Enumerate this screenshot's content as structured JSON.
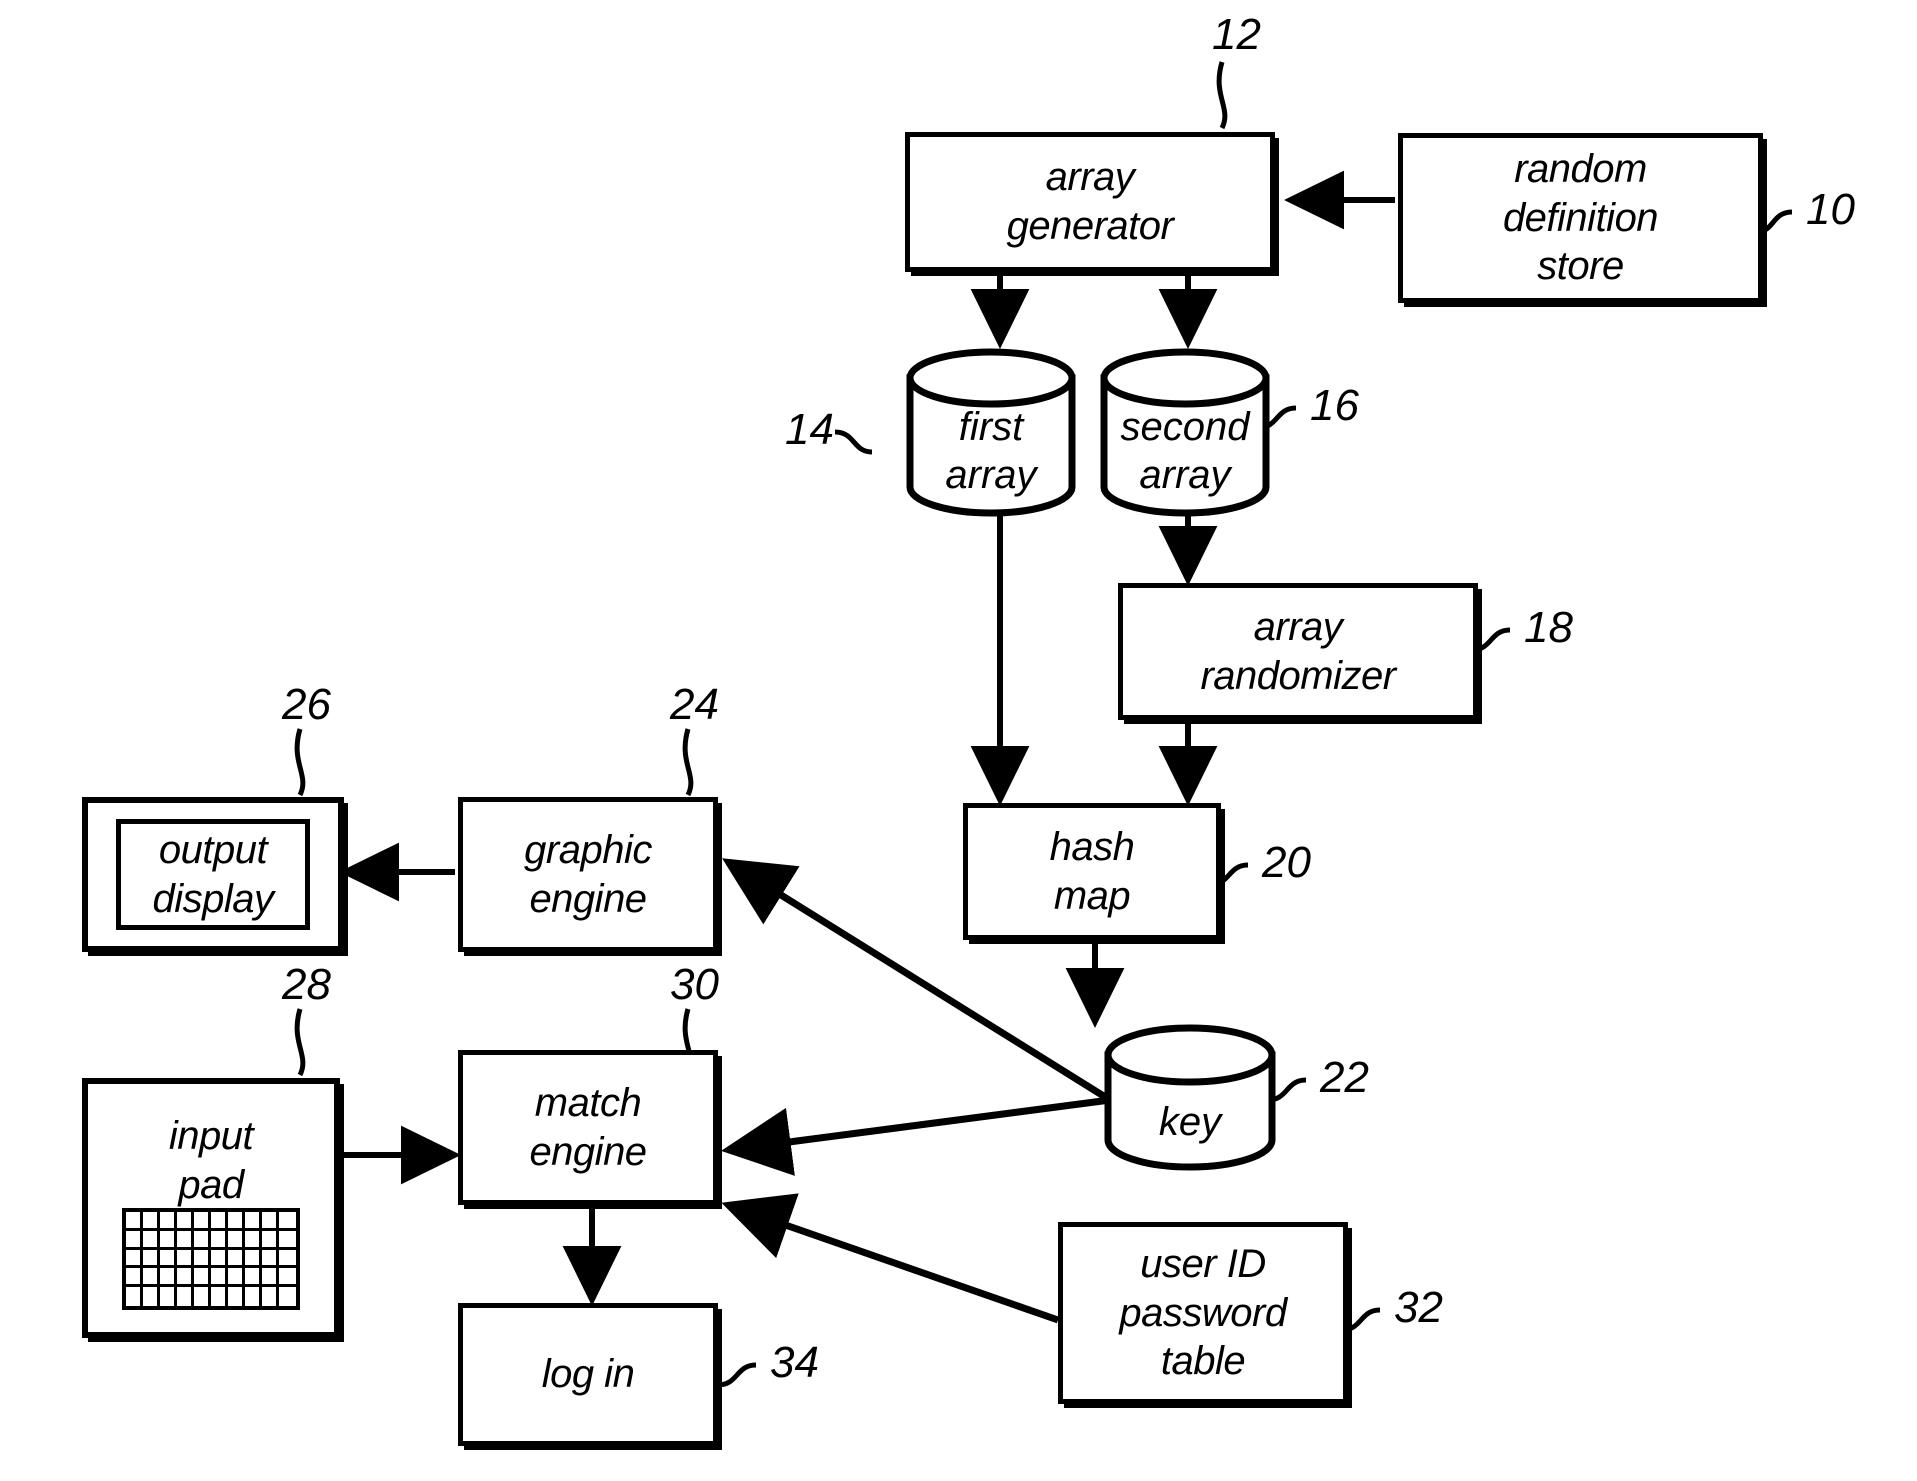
{
  "figure": {
    "type": "patent-block-diagram",
    "background": "#ffffff",
    "stroke": "#000000"
  },
  "nodes": {
    "array_generator": {
      "line1": "array",
      "line2": "generator",
      "ref": "12"
    },
    "random_definition_store": {
      "line1": "random",
      "line2": "definition",
      "line3": "store",
      "ref": "10"
    },
    "first_array": {
      "line1": "first",
      "line2": "array",
      "ref": "14"
    },
    "second_array": {
      "line1": "second",
      "line2": "array",
      "ref": "16"
    },
    "array_randomizer": {
      "line1": "array",
      "line2": "randomizer",
      "ref": "18"
    },
    "hash_map": {
      "line1": "hash",
      "line2": "map",
      "ref": "20"
    },
    "key": {
      "line1": "key",
      "ref": "22"
    },
    "graphic_engine": {
      "line1": "graphic",
      "line2": "engine",
      "ref": "24"
    },
    "output_display": {
      "line1": "output",
      "line2": "display",
      "ref": "26"
    },
    "input_pad": {
      "line1": "input",
      "line2": "pad",
      "ref": "28"
    },
    "match_engine": {
      "line1": "match",
      "line2": "engine",
      "ref": "30"
    },
    "user_id_password_table": {
      "line1": "user ID",
      "line2": "password",
      "line3": "table",
      "ref": "32"
    },
    "log_in": {
      "line1": "log in",
      "ref": "34"
    }
  },
  "input_pad_grid": {
    "columns": 10,
    "rows": 5
  },
  "connections": [
    {
      "from": "random_definition_store",
      "to": "array_generator",
      "style": "arrow"
    },
    {
      "from": "array_generator",
      "to": "first_array",
      "style": "arrow"
    },
    {
      "from": "array_generator",
      "to": "second_array",
      "style": "arrow"
    },
    {
      "from": "second_array",
      "to": "array_randomizer",
      "style": "arrow"
    },
    {
      "from": "array_randomizer",
      "to": "hash_map",
      "style": "arrow"
    },
    {
      "from": "first_array",
      "to": "hash_map",
      "style": "arrow"
    },
    {
      "from": "hash_map",
      "to": "key",
      "style": "arrow"
    },
    {
      "from": "key",
      "to": "graphic_engine",
      "style": "arrow"
    },
    {
      "from": "key",
      "to": "match_engine",
      "style": "arrow"
    },
    {
      "from": "graphic_engine",
      "to": "output_display",
      "style": "arrow"
    },
    {
      "from": "input_pad",
      "to": "match_engine",
      "style": "arrow"
    },
    {
      "from": "user_id_password_table",
      "to": "match_engine",
      "style": "arrow"
    },
    {
      "from": "match_engine",
      "to": "log_in",
      "style": "arrow"
    }
  ]
}
